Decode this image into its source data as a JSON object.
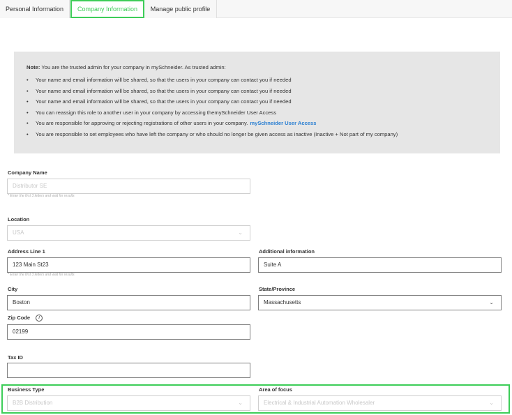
{
  "tabs": [
    {
      "label": "Personal Information"
    },
    {
      "label": "Company Information"
    },
    {
      "label": "Manage public profile"
    }
  ],
  "note": {
    "prefix": "Note:",
    "text": " You are the trusted admin for your company in mySchneider. As trusted admin:",
    "items": [
      "Your name and email information will be shared, so that the users in your company can contact you if needed",
      "Your name and email information will be shared, so that the users in your company can contact you if needed",
      "Your name and email information will be shared, so that the users in your company can contact you if needed",
      "You can reassign this role to another user in your company by accessing themySchneider User Access",
      "You are responsible for approving or rejecting registrations of other users in your company.",
      "You are responsible to set employees who have left the company or who should no longer be given access as inactive (Inactive + Not part of my company)"
    ],
    "link_text": "mySchneider User Access"
  },
  "form": {
    "company_name": {
      "label": "Company Name",
      "value": "Distributor SE",
      "hint": "* Enter the first 3 letters and wait for results"
    },
    "location": {
      "label": "Location",
      "value": "USA"
    },
    "address1": {
      "label": "Address Line 1",
      "value": "123 Main St23",
      "hint": "* Enter the first 3 letters and wait for results"
    },
    "additional_info": {
      "label": "Additional information",
      "value": "Suite A"
    },
    "city": {
      "label": "City",
      "value": "Boston"
    },
    "state": {
      "label": "State/Province",
      "value": "Massachusetts"
    },
    "zip": {
      "label": "Zip Code",
      "value": "02199"
    },
    "tax_id": {
      "label": "Tax ID",
      "value": ""
    },
    "business_type": {
      "label": "Business Type",
      "value": "B2B Distribution"
    },
    "area_of_focus": {
      "label": "Area of focus",
      "value": "Electrical & Industrial Automation Wholesaler"
    }
  },
  "icons": {
    "info": "info-icon",
    "dropdown": "chevron-down-icon"
  },
  "colors": {
    "accent": "#3dcd58",
    "link": "#2a7fd2",
    "note_bg": "#e6e6e6"
  }
}
